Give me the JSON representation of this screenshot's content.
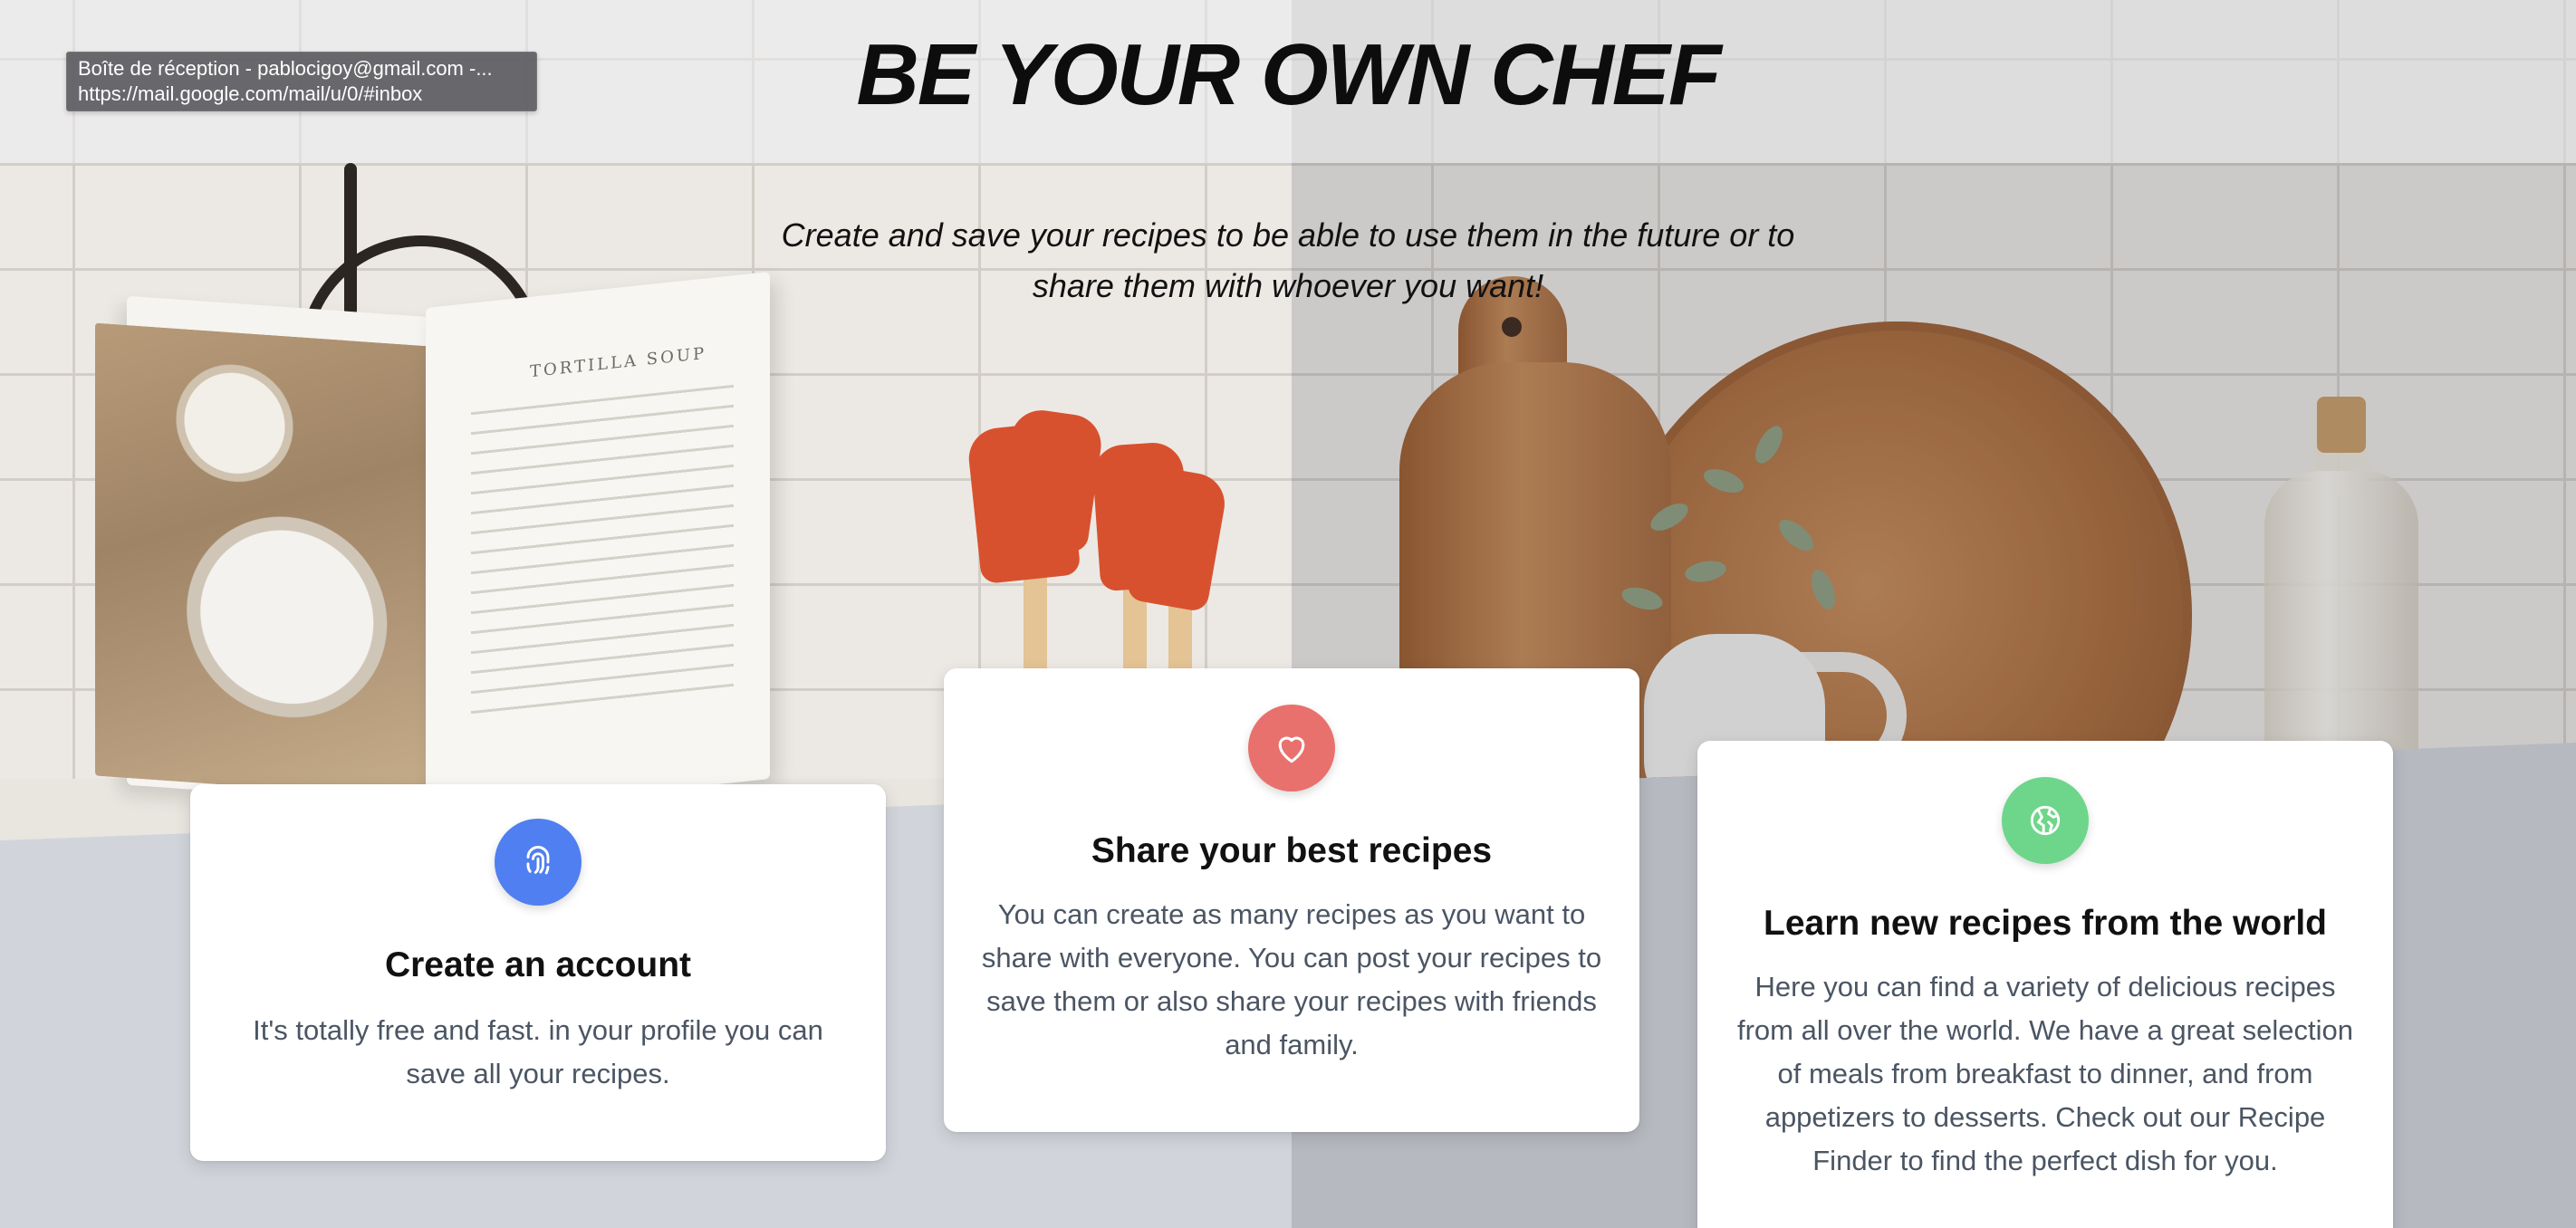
{
  "tooltip": {
    "line1": "Boîte de réception - pablocigoy@gmail.com -...",
    "line2": "https://mail.google.com/mail/u/0/#inbox"
  },
  "hero": {
    "title": "BE YOUR OWN CHEF",
    "subtitle": "Create and save your recipes to be able to use them in the future or to share them with whoever you want!",
    "image_text": "TORTILLA SOUP"
  },
  "cards": [
    {
      "icon": "fingerprint-icon",
      "icon_color": "#4f7ff0",
      "title": "Create an account",
      "text": "It's totally free and fast. in your profile you can save all your recipes."
    },
    {
      "icon": "heart-icon",
      "icon_color": "#e8716d",
      "title": "Share your best recipes",
      "text": "You can create as many recipes as you want to share with everyone. You can post your recipes to save them or also share your recipes with friends and family."
    },
    {
      "icon": "globe-icon",
      "icon_color": "#6ed68a",
      "title": "Learn new recipes from the world",
      "text": "Here you can find a variety of delicious recipes from all over the world. We have a great selection of meals from breakfast to dinner, and from appetizers to desserts. Check out our Recipe Finder to find the perfect dish for you."
    }
  ]
}
